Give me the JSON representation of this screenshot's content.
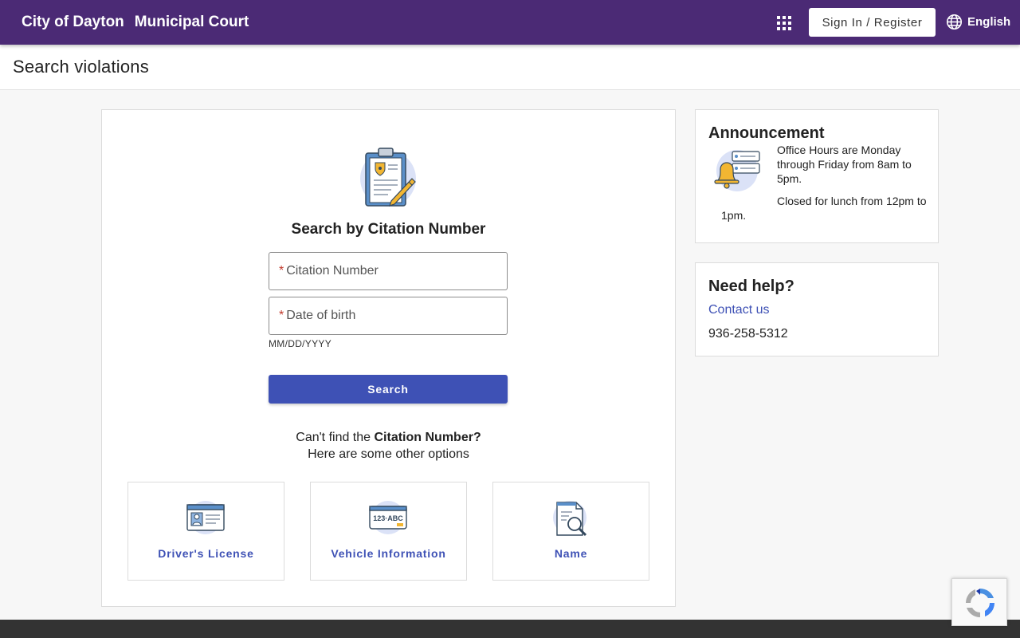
{
  "header": {
    "brand_city": "City of Dayton",
    "brand_court": "Municipal Court",
    "signin_label": "Sign In / Register",
    "language": "English",
    "apps_icon": "apps-grid-icon",
    "language_icon": "globe-icon"
  },
  "page": {
    "title": "Search violations"
  },
  "search": {
    "title": "Search by Citation Number",
    "citation_placeholder": "Citation Number",
    "dob_placeholder": "Date of birth",
    "required_mark": "*",
    "dob_hint": "MM/DD/YYYY",
    "button_label": "Search",
    "alt_prefix": "Can't find the ",
    "alt_bold": "Citation Number?",
    "alt_line2": "Here are some other options",
    "options": [
      {
        "label": "Driver's License",
        "icon": "drivers-license-icon"
      },
      {
        "label": "Vehicle Information",
        "icon": "license-plate-icon",
        "plate_text": "123·ABC"
      },
      {
        "label": "Name",
        "icon": "name-search-icon"
      }
    ]
  },
  "announcement": {
    "title": "Announcement",
    "line1": "Office Hours are Monday through Friday from 8am to 5pm.",
    "line2": "Closed for lunch from 12pm to 1pm."
  },
  "help": {
    "title": "Need help?",
    "contact_label": "Contact us",
    "phone": "936-258-5312"
  },
  "colors": {
    "header_bg": "#4b2a75",
    "primary": "#3e51b5",
    "required": "#c0392b"
  }
}
